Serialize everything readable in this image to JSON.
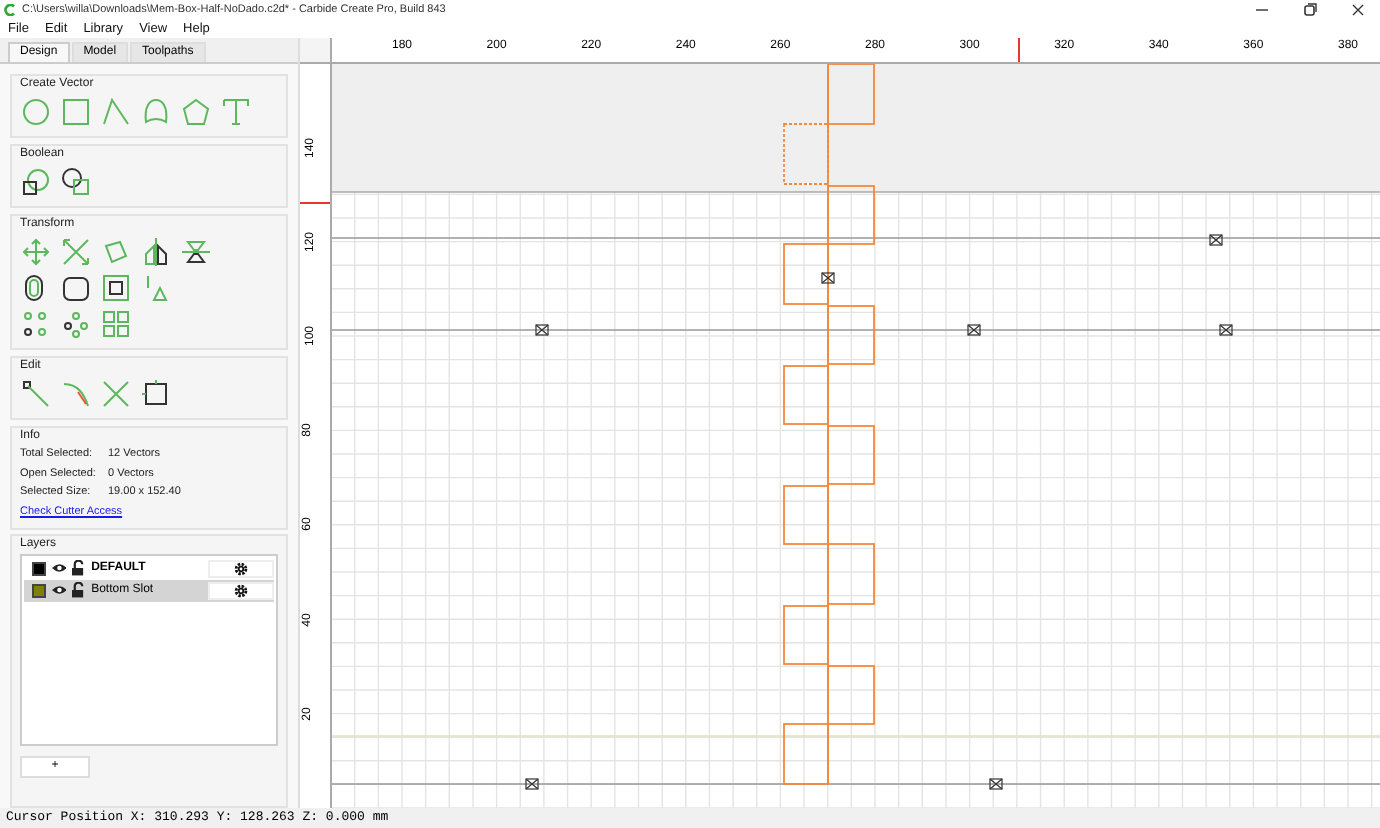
{
  "window": {
    "title": "C:\\Users\\willa\\Downloads\\Mem-Box-Half-NoDado.c2d* - Carbide Create Pro, Build 843"
  },
  "menu": [
    "File",
    "Edit",
    "Library",
    "View",
    "Help"
  ],
  "tabs": [
    {
      "label": "Design",
      "selected": true
    },
    {
      "label": "Model",
      "selected": false
    },
    {
      "label": "Toolpaths",
      "selected": false
    }
  ],
  "tool_groups": [
    {
      "title": "Create Vector"
    },
    {
      "title": "Boolean"
    },
    {
      "title": "Transform"
    },
    {
      "title": "Edit"
    }
  ],
  "info": {
    "title": "Info",
    "rows": [
      {
        "label": "Total Selected:",
        "value": "12 Vectors"
      },
      {
        "label": "Open Selected:",
        "value": "0 Vectors"
      },
      {
        "label": "Selected Size:",
        "value": "19.00 x 152.40"
      }
    ],
    "link": "Check Cutter Access"
  },
  "layers": {
    "title": "Layers",
    "items": [
      {
        "name": "DEFAULT",
        "color": "#000000",
        "selected": false
      },
      {
        "name": "Bottom Slot",
        "color": "#808000",
        "selected": true
      }
    ],
    "add_button": "+"
  },
  "ruler": {
    "x_labels": [
      "180",
      "200",
      "220",
      "240",
      "260",
      "280",
      "300",
      "320",
      "340",
      "360",
      "380"
    ],
    "y_labels": [
      "140",
      "120",
      "100",
      "80",
      "60",
      "40",
      "20"
    ]
  },
  "status_bar": "Cursor Position X: 310.293 Y: 128.263 Z: 0.000 mm"
}
